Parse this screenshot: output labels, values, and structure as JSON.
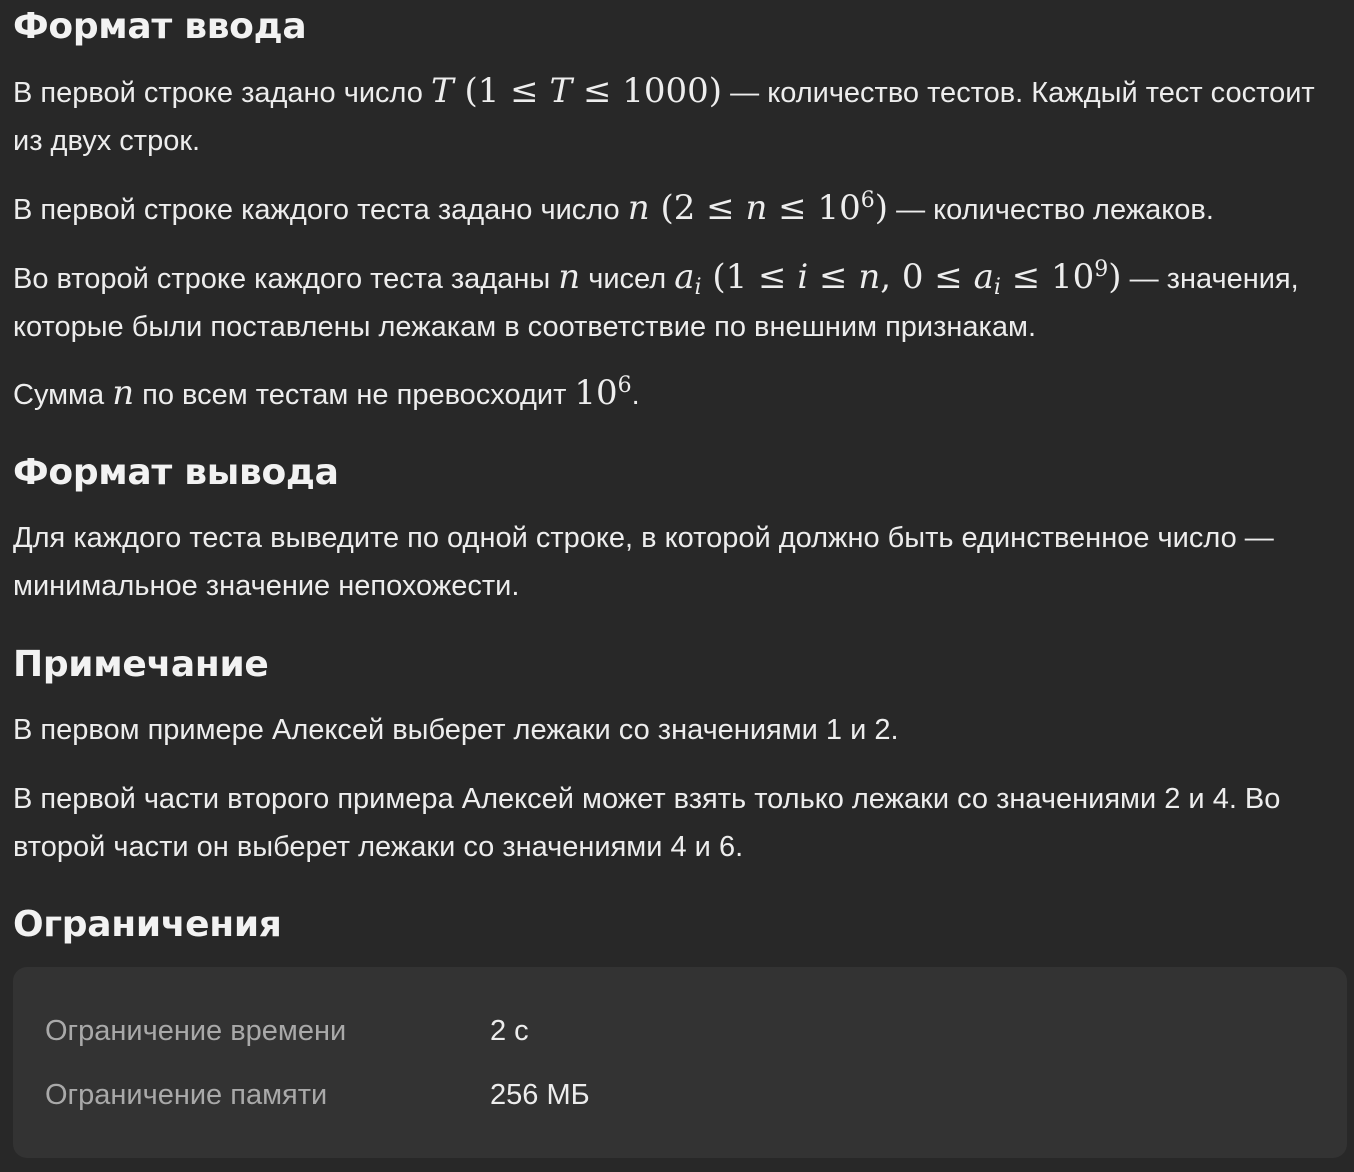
{
  "input_format": {
    "title": "Формат ввода",
    "p1": {
      "a": "В первой строке задано число ",
      "T": "T",
      "b": " (1 ≤ ",
      "T2": "T",
      "c": " ≤ 1000)",
      "d": " — количество тестов. Каждый тест состоит из двух строк."
    },
    "p2": {
      "a": "В первой строке каждого теста задано число ",
      "n": "n",
      "b": " (2 ≤ ",
      "n2": "n",
      "c": " ≤ 10",
      "exp": "6",
      "d": ")",
      "e": " — количество лежаков."
    },
    "p3": {
      "a": "Во второй строке каждого теста заданы ",
      "n": "n",
      "b": " чисел ",
      "ai": "a",
      "i": "i",
      "c": " (1 ≤ ",
      "i2": "i",
      "d": " ≤ ",
      "n2": "n",
      "e": ", 0 ≤ ",
      "ai2": "a",
      "i3": "i",
      "f": " ≤ 10",
      "exp": "9",
      "g": ")",
      "h": " — значения, которые были поставлены лежакам в соответствие по внешним признакам."
    },
    "p4": {
      "a": "Сумма ",
      "n": "n",
      "b": " по всем тестам не превосходит ",
      "c": "10",
      "exp": "6",
      "d": "."
    }
  },
  "output_format": {
    "title": "Формат вывода",
    "text": "Для каждого теста выведите по одной строке, в которой должно быть единственное число — минимальное значение непохожести."
  },
  "note": {
    "title": "Примечание",
    "p1": "В первом примере Алексей выберет лежаки со значениями 1 и 2.",
    "p2": "В первой части второго примера Алексей может взять только лежаки со значениями 2 и 4. Во второй части он выберет лежаки со значениями 4 и 6."
  },
  "limits": {
    "title": "Ограничения",
    "rows": [
      {
        "name": "Ограничение времени",
        "value": "2 с"
      },
      {
        "name": "Ограничение памяти",
        "value": "256 МБ"
      }
    ]
  }
}
